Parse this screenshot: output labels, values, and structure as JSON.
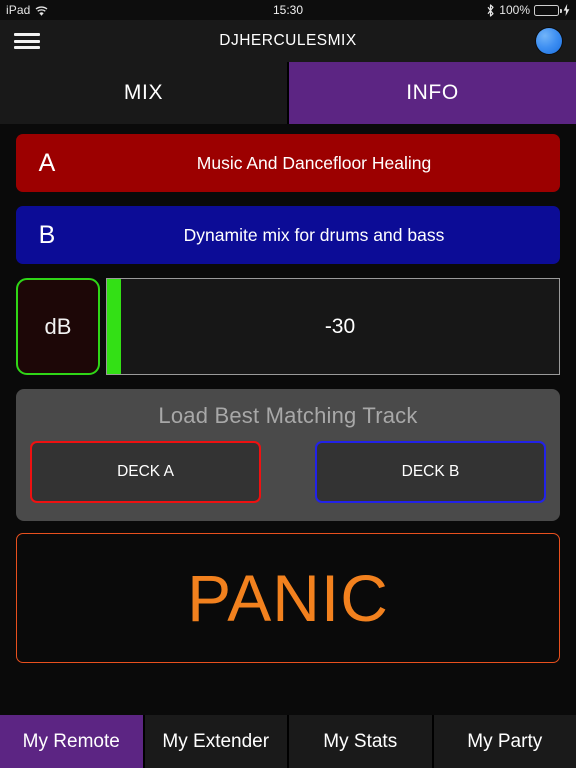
{
  "status_bar": {
    "device": "iPad",
    "wifi_icon": "wifi-icon",
    "time": "15:30",
    "bluetooth_icon": "bluetooth-icon",
    "battery_percent": "100%",
    "battery_level": 100,
    "charging_icon": "charging-bolt-icon",
    "battery_color": "#3ad63a"
  },
  "nav_bar": {
    "menu_icon": "hamburger-menu-icon",
    "title": "DJHERCULESMIX",
    "avatar_icon": "user-avatar-icon",
    "avatar_color": "#3e8ff2"
  },
  "segment_tabs": {
    "active_color": "#5c2583",
    "items": [
      {
        "label": "MIX",
        "active": false
      },
      {
        "label": "INFO",
        "active": true
      }
    ]
  },
  "decks": [
    {
      "letter": "A",
      "title": "Music And Dancefloor Healing",
      "color": "#9c0000"
    },
    {
      "letter": "B",
      "title": "Dynamite mix for drums and bass",
      "color": "#0c0c96"
    }
  ],
  "meter": {
    "db_label": "dB",
    "db_border_color": "#2fd617",
    "value": "-30",
    "level_color": "#33e015"
  },
  "load_panel": {
    "title": "Load Best Matching Track",
    "buttons": [
      {
        "label": "DECK A",
        "border_color": "#ee1111"
      },
      {
        "label": "DECK B",
        "border_color": "#2222e8"
      }
    ]
  },
  "panic": {
    "label": "PANIC",
    "text_color": "#f2811e",
    "border_color": "#e8501e"
  },
  "tab_bar": {
    "active_color": "#5c2583",
    "items": [
      {
        "label": "My Remote",
        "active": true
      },
      {
        "label": "My Extender",
        "active": false
      },
      {
        "label": "My Stats",
        "active": false
      },
      {
        "label": "My Party",
        "active": false
      }
    ]
  }
}
